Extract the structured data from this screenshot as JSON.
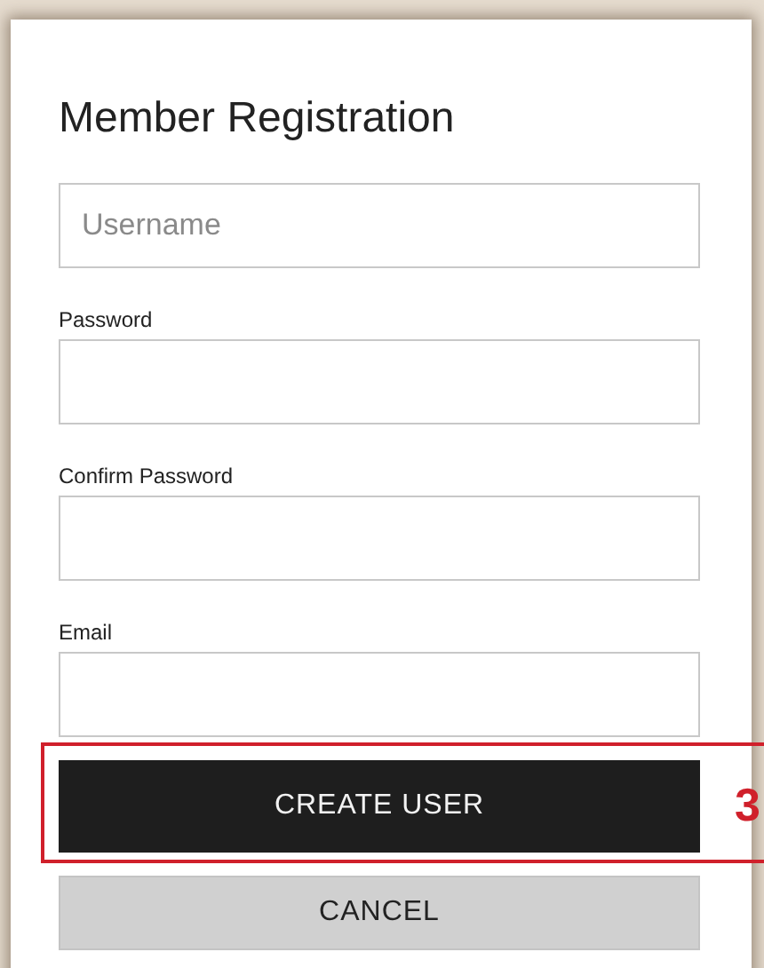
{
  "title": "Member Registration",
  "fields": [
    {
      "placeholder": "Username"
    },
    {
      "label": "Password"
    },
    {
      "label": "Confirm Password"
    },
    {
      "label": "Email"
    }
  ],
  "buttons": [
    {
      "label": "CREATE USER",
      "kind": "primary",
      "annotation": "3"
    },
    {
      "label": "CANCEL",
      "kind": "secondary"
    }
  ]
}
